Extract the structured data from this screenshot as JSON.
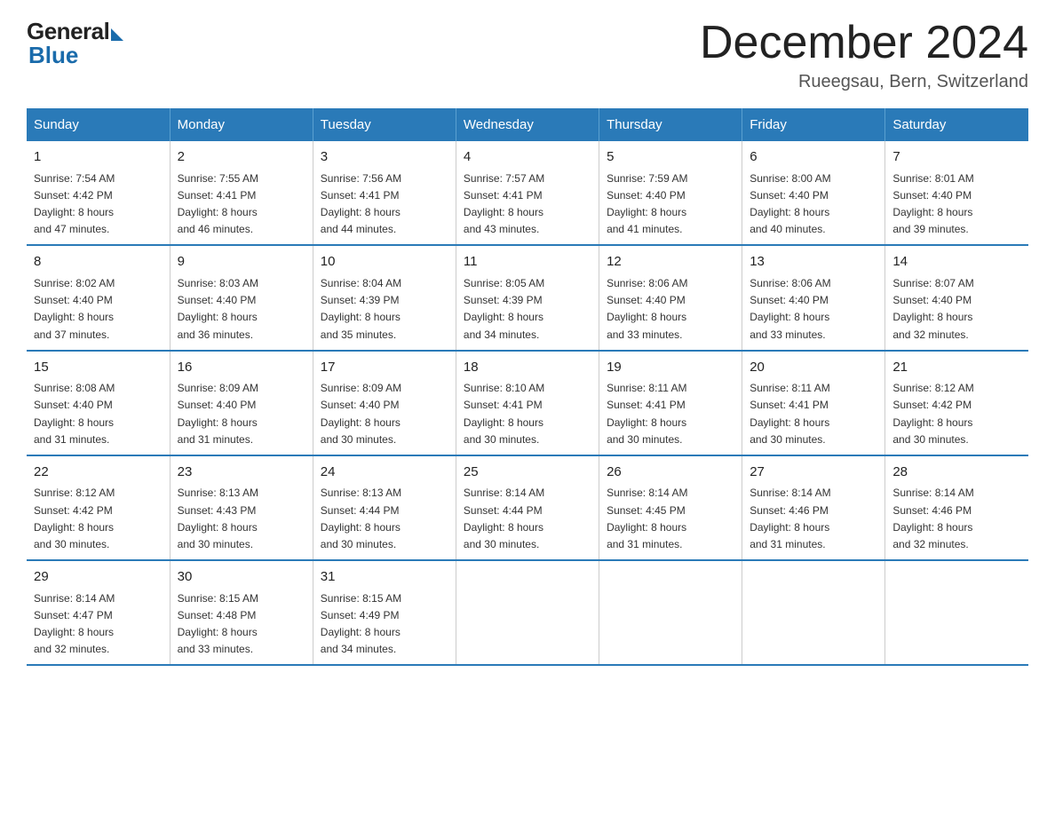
{
  "header": {
    "logo_general": "General",
    "logo_blue": "Blue",
    "month_title": "December 2024",
    "location": "Rueegsau, Bern, Switzerland"
  },
  "days_of_week": [
    "Sunday",
    "Monday",
    "Tuesday",
    "Wednesday",
    "Thursday",
    "Friday",
    "Saturday"
  ],
  "weeks": [
    [
      {
        "day": "1",
        "sunrise": "7:54 AM",
        "sunset": "4:42 PM",
        "daylight": "8 hours and 47 minutes."
      },
      {
        "day": "2",
        "sunrise": "7:55 AM",
        "sunset": "4:41 PM",
        "daylight": "8 hours and 46 minutes."
      },
      {
        "day": "3",
        "sunrise": "7:56 AM",
        "sunset": "4:41 PM",
        "daylight": "8 hours and 44 minutes."
      },
      {
        "day": "4",
        "sunrise": "7:57 AM",
        "sunset": "4:41 PM",
        "daylight": "8 hours and 43 minutes."
      },
      {
        "day": "5",
        "sunrise": "7:59 AM",
        "sunset": "4:40 PM",
        "daylight": "8 hours and 41 minutes."
      },
      {
        "day": "6",
        "sunrise": "8:00 AM",
        "sunset": "4:40 PM",
        "daylight": "8 hours and 40 minutes."
      },
      {
        "day": "7",
        "sunrise": "8:01 AM",
        "sunset": "4:40 PM",
        "daylight": "8 hours and 39 minutes."
      }
    ],
    [
      {
        "day": "8",
        "sunrise": "8:02 AM",
        "sunset": "4:40 PM",
        "daylight": "8 hours and 37 minutes."
      },
      {
        "day": "9",
        "sunrise": "8:03 AM",
        "sunset": "4:40 PM",
        "daylight": "8 hours and 36 minutes."
      },
      {
        "day": "10",
        "sunrise": "8:04 AM",
        "sunset": "4:39 PM",
        "daylight": "8 hours and 35 minutes."
      },
      {
        "day": "11",
        "sunrise": "8:05 AM",
        "sunset": "4:39 PM",
        "daylight": "8 hours and 34 minutes."
      },
      {
        "day": "12",
        "sunrise": "8:06 AM",
        "sunset": "4:40 PM",
        "daylight": "8 hours and 33 minutes."
      },
      {
        "day": "13",
        "sunrise": "8:06 AM",
        "sunset": "4:40 PM",
        "daylight": "8 hours and 33 minutes."
      },
      {
        "day": "14",
        "sunrise": "8:07 AM",
        "sunset": "4:40 PM",
        "daylight": "8 hours and 32 minutes."
      }
    ],
    [
      {
        "day": "15",
        "sunrise": "8:08 AM",
        "sunset": "4:40 PM",
        "daylight": "8 hours and 31 minutes."
      },
      {
        "day": "16",
        "sunrise": "8:09 AM",
        "sunset": "4:40 PM",
        "daylight": "8 hours and 31 minutes."
      },
      {
        "day": "17",
        "sunrise": "8:09 AM",
        "sunset": "4:40 PM",
        "daylight": "8 hours and 30 minutes."
      },
      {
        "day": "18",
        "sunrise": "8:10 AM",
        "sunset": "4:41 PM",
        "daylight": "8 hours and 30 minutes."
      },
      {
        "day": "19",
        "sunrise": "8:11 AM",
        "sunset": "4:41 PM",
        "daylight": "8 hours and 30 minutes."
      },
      {
        "day": "20",
        "sunrise": "8:11 AM",
        "sunset": "4:41 PM",
        "daylight": "8 hours and 30 minutes."
      },
      {
        "day": "21",
        "sunrise": "8:12 AM",
        "sunset": "4:42 PM",
        "daylight": "8 hours and 30 minutes."
      }
    ],
    [
      {
        "day": "22",
        "sunrise": "8:12 AM",
        "sunset": "4:42 PM",
        "daylight": "8 hours and 30 minutes."
      },
      {
        "day": "23",
        "sunrise": "8:13 AM",
        "sunset": "4:43 PM",
        "daylight": "8 hours and 30 minutes."
      },
      {
        "day": "24",
        "sunrise": "8:13 AM",
        "sunset": "4:44 PM",
        "daylight": "8 hours and 30 minutes."
      },
      {
        "day": "25",
        "sunrise": "8:14 AM",
        "sunset": "4:44 PM",
        "daylight": "8 hours and 30 minutes."
      },
      {
        "day": "26",
        "sunrise": "8:14 AM",
        "sunset": "4:45 PM",
        "daylight": "8 hours and 31 minutes."
      },
      {
        "day": "27",
        "sunrise": "8:14 AM",
        "sunset": "4:46 PM",
        "daylight": "8 hours and 31 minutes."
      },
      {
        "day": "28",
        "sunrise": "8:14 AM",
        "sunset": "4:46 PM",
        "daylight": "8 hours and 32 minutes."
      }
    ],
    [
      {
        "day": "29",
        "sunrise": "8:14 AM",
        "sunset": "4:47 PM",
        "daylight": "8 hours and 32 minutes."
      },
      {
        "day": "30",
        "sunrise": "8:15 AM",
        "sunset": "4:48 PM",
        "daylight": "8 hours and 33 minutes."
      },
      {
        "day": "31",
        "sunrise": "8:15 AM",
        "sunset": "4:49 PM",
        "daylight": "8 hours and 34 minutes."
      },
      null,
      null,
      null,
      null
    ]
  ],
  "labels": {
    "sunrise": "Sunrise:",
    "sunset": "Sunset:",
    "daylight": "Daylight:"
  }
}
